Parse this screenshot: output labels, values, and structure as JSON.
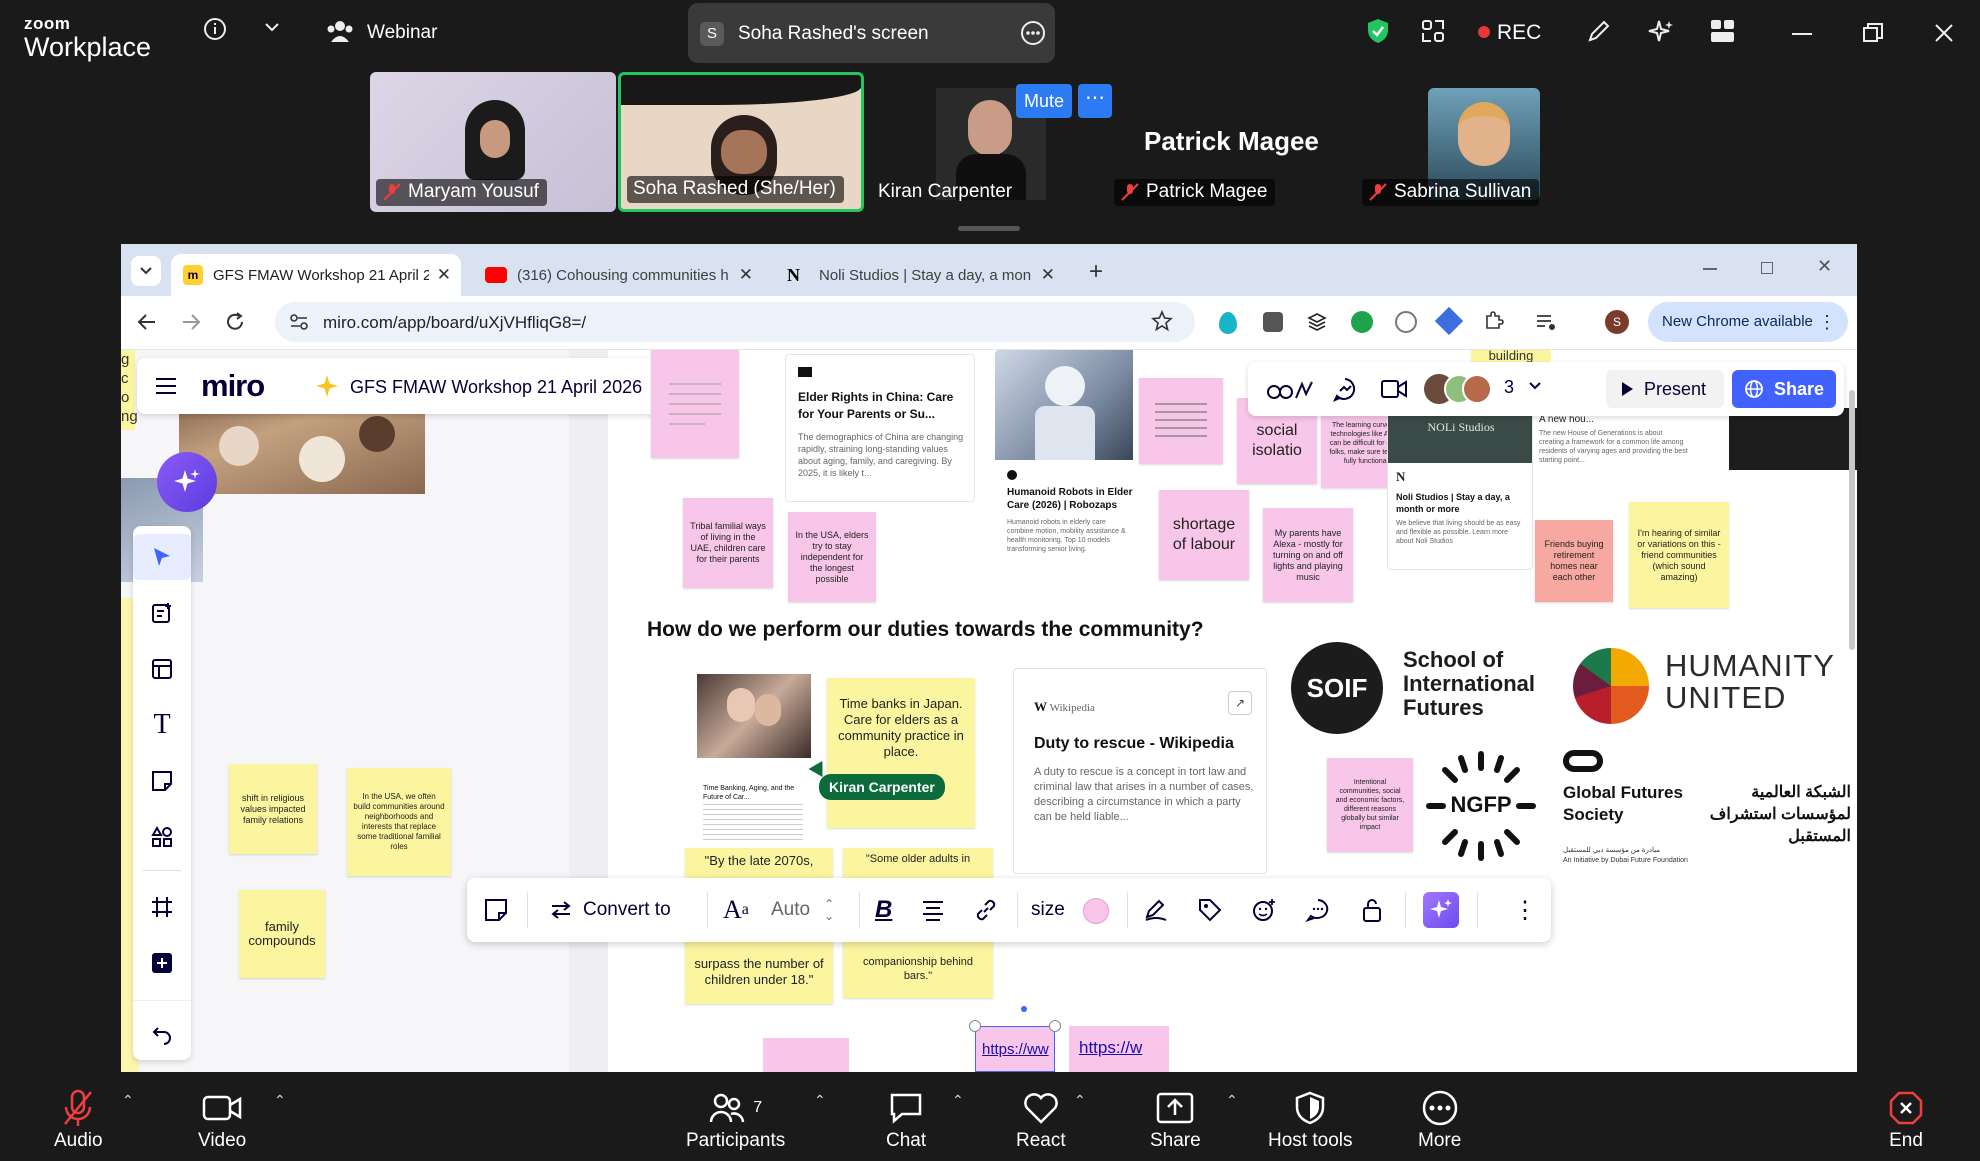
{
  "zoom": {
    "logo_line1": "zoom",
    "logo_line2": "Workplace",
    "meeting_type": "Webinar",
    "screen_share_label": "Soha Rashed's screen",
    "screen_share_initial": "S",
    "rec_label": "REC",
    "mute_label": "Mute",
    "participants": [
      {
        "name": "Maryam Yousuf",
        "muted": true
      },
      {
        "name": "Soha Rashed (She/Her)",
        "muted": false
      },
      {
        "name": "Kiran Carpenter",
        "muted": false
      },
      {
        "name": "Patrick Magee",
        "muted": true,
        "big_name": "Patrick Magee"
      },
      {
        "name": "Sabrina Sullivan",
        "muted": true
      }
    ],
    "bottom": {
      "audio": "Audio",
      "video": "Video",
      "participants": "Participants",
      "participants_count": "7",
      "chat": "Chat",
      "react": "React",
      "share": "Share",
      "host_tools": "Host tools",
      "more": "More",
      "end": "End"
    }
  },
  "browser": {
    "tabs": [
      {
        "title": "GFS FMAW Workshop 21 April 2",
        "active": true
      },
      {
        "title": "(316) Cohousing communities h",
        "active": false
      },
      {
        "title": "Noli Studios | Stay a day, a mon",
        "active": false
      }
    ],
    "url": "miro.com/app/board/uXjVHfliqG8=/",
    "new_chrome": "New Chrome available",
    "profile_initial": "S"
  },
  "miro": {
    "logo": "miro",
    "board_title": "GFS FMAW Workshop 21 April 2026",
    "present": "Present",
    "share": "Share",
    "collab_count": "3",
    "heading": "How do we perform our duties towards the community?",
    "cursor_label": "Kiran Carpenter",
    "toolbar": {
      "convert": "Convert to",
      "auto": "Auto",
      "size": "size"
    },
    "cards": {
      "elder_rights_title": "Elder Rights in China: Care for Your Parents or Su...",
      "elder_rights_body": "The demographics of China are changing rapidly, straining long-standing values about aging, family, and caregiving. By 2025, it is likely t...",
      "humanoid_title": "Humanoid Robots in Elder Care (2026) | Robozaps",
      "humanoid_body": "Humanoid robots in elderly care combine motion, mobility assistance & health monitoring. Top 10 models transforming senior living.",
      "noli_title": "Noli Studios | Stay a day, a month or more",
      "noli_body": "We believe that living should be as easy and flexible as possible. Learn more about Noli Studios",
      "noli_logo": "NOLi Studios",
      "new_house": "A new hou...",
      "new_house_body": "The new House of Generations is about creating a framework for a common life among residents of varying ages and providing the best starting point...",
      "timebank_title": "Time Banking, Aging, and the Future of Car...",
      "wiki_source": "Wikipedia",
      "wiki_title": "Duty to rescue - Wikipedia",
      "wiki_body": "A duty to rescue is a concept in tort law and criminal law that arises in a number of cases, describing a circumstance in which a party can be held liable...",
      "link1": "https://ww",
      "link2": "https://w",
      "building": "building"
    },
    "stickies": {
      "tribal": "Tribal familial ways of living in the UAE, children care for their parents",
      "usa_independent": "In the USA, elders try to stay independent for the longest possible",
      "social_isolation": "social isolatio",
      "learning_curve": "The learning curve for technologies like Alexa can be difficult for elder folks, make sure tech is fully functional",
      "shortage": "shortage of labour",
      "alexa": "My parents have Alexa - mostly for turning on and off lights and playing music",
      "friends": "Friends buying retirement homes near each other",
      "hearing": "I'm hearing of similar or variations on this - friend communities (which sound amazing)",
      "religious": "shift in religious values impacted family relations",
      "usa_communities": "In the USA, we often build communities around neighborhoods and interests that replace some traditional familial roles",
      "compounds": "family compounds",
      "timebanks": "Time banks in Japan. Care for elders as a community practice in place.",
      "intentional": "Intentional communities, social and economic factors, different reasons globally but similar impact",
      "by_2070": "\"By the late 2070s,",
      "surpass": "surpass the number of children under 18.\"",
      "older_adults": "\"Some older adults in",
      "companionship": "companionship behind bars.\""
    },
    "logos": {
      "soif_mark": "SOIF",
      "soif_line1": "School of",
      "soif_line2": "International",
      "soif_line3": "Futures",
      "humanity_line1": "HUMANITY",
      "humanity_line2": "UNITED",
      "ngfp": "NGFP",
      "gfs_en1": "Global Futures",
      "gfs_en2": "Society",
      "gfs_ar1": "الشبكة العالمية",
      "gfs_ar2": "لمؤسسات استشراف المستقبل",
      "gfs_initiative": "An Initiative by Dubai Future Foundation",
      "gfs_ar_initiative": "مبادرة من مؤسسة دبي للمستقبل"
    },
    "left_fragments": [
      "g",
      "c",
      "o",
      "ng"
    ]
  }
}
